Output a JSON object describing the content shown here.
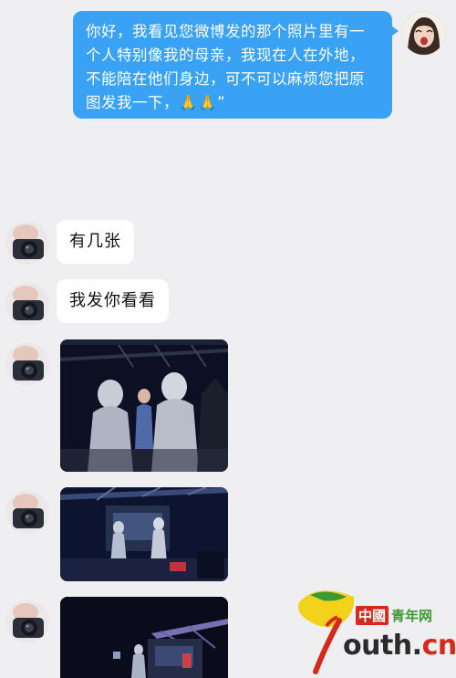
{
  "conversation": {
    "outgoing": {
      "text": "你好，我看见您微博发的那个照片里有一个人特别像我的母亲，我现在人在外地，不能陪在他们身边，可不可以麻烦您把原图发我一下，🙏🙏”"
    },
    "incoming_texts": [
      "有几张",
      "我发你看看"
    ]
  },
  "watermark": {
    "brand_red": "中國",
    "brand_green": "青年网",
    "domain_main": "outh.",
    "domain_tld": "cn"
  },
  "colors": {
    "bubble_out": "#3aa2f5",
    "bubble_in": "#ffffff",
    "background": "#efeff2",
    "logo_red": "#d42a1c",
    "logo_green": "#3d9a33",
    "logo_yellow": "#f2d21d"
  }
}
